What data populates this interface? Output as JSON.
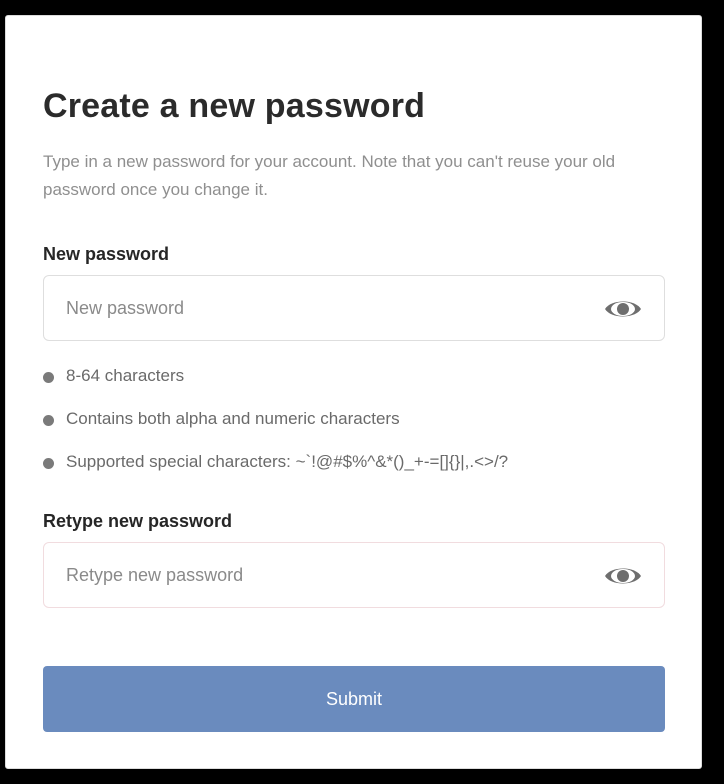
{
  "form": {
    "title": "Create a new password",
    "description": "Type in a new password for your account. Note that you can't reuse your old password once you change it.",
    "new_password": {
      "label": "New password",
      "value": "",
      "placeholder": "New password",
      "toggle_icon": "eye-icon"
    },
    "requirements": [
      "8-64 characters",
      "Contains both alpha and numeric characters",
      "Supported special characters: ~`!@#$%^&*()_+-=[]{}|,.<>/?"
    ],
    "retype_password": {
      "label": "Retype new password",
      "value": "",
      "placeholder": "Retype new password",
      "toggle_icon": "eye-icon"
    },
    "submit_label": "Submit"
  },
  "colors": {
    "submit_background": "#6a8bbe",
    "title_text": "#2b2b2b",
    "muted_text": "#8f8f8f",
    "bullet": "#7a7a7a",
    "eye_icon": "#6e6e6e"
  }
}
